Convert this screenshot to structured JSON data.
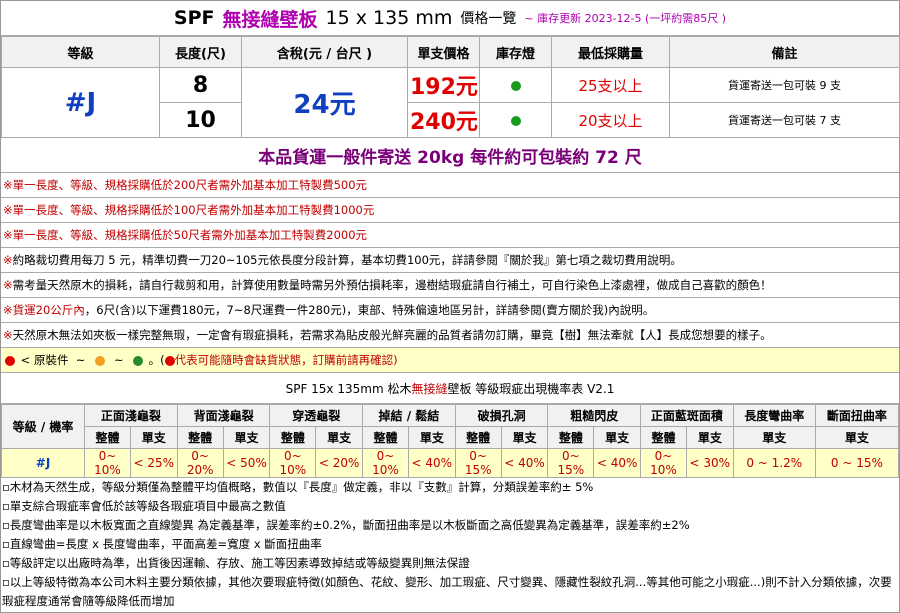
{
  "title": {
    "brand": "SPF",
    "product": "無接縫壁板",
    "spec": "15 x 135 mm",
    "suffix": "價格一覽",
    "update": "~ 庫存更新 2023-12-5 (一坪約需85尺 )"
  },
  "table": {
    "headers": [
      "等級",
      "長度(尺)",
      "含稅(元 / 台尺 )",
      "單支價格",
      "庫存燈",
      "最低採購量",
      "備註"
    ],
    "grade": "#J",
    "price_per_ft": "24元",
    "rows": [
      {
        "length": "8",
        "unit_price": "192元",
        "stock": "green",
        "min_buy": "25支以上",
        "note": "貨運寄送一包可裝 9 支"
      },
      {
        "length": "10",
        "unit_price": "240元",
        "stock": "green",
        "min_buy": "20支以上",
        "note": "貨運寄送一包可裝 7 支"
      }
    ]
  },
  "shipping": "本品貨運一般件寄送 20kg 每件約可包裝約 72 尺",
  "notes": [
    {
      "text": "※單一長度、等級、規格採購低於200尺者需外加基本加工特製費500元",
      "color": "red"
    },
    {
      "text": "※單一長度、等級、規格採購低於100尺者需外加基本加工特製費1000元",
      "color": "red"
    },
    {
      "text": "※單一長度、等級、規格採購低於50尺者需外加基本加工特製費2000元",
      "color": "red"
    },
    {
      "text": "約略裁切費用每刀 5 元，精準切費一刀20~105元依長度分段計算，基本切費100元，詳請參閱『關於我』第七項之裁切費用說明。",
      "color": "black",
      "mark": "※"
    },
    {
      "text": "需考量天然原木的損耗，請自行裁剪和用，計算使用數量時需另外預估損耗率，邊樹結瑕疵請自行補土，可自行染色上漆處裡，做成自己喜歡的顏色！",
      "color": "black",
      "mark": "※"
    },
    {
      "text": "貨運20公斤內，6尺(含)以下運費180元，7~8尺運費一件280元)，東部、特殊偏遠地區另計，詳請參閱(賣方關於我)內說明。",
      "color": "black",
      "mark": "※",
      "lead_red": "貨運20公斤內"
    },
    {
      "text": "天然原木無法如夾板一樣完整無瑕，一定會有瑕疵損耗，若需求為貼皮般光鮮亮麗的品質者請勿訂購，畢竟【樹】無法牽就【人】長成您想要的樣子。",
      "color": "black",
      "mark": "※"
    }
  ],
  "legend": {
    "label": "< 原裝件",
    "sep": "~",
    "tail": "。(",
    "warning": "代表可能隨時會缺貨狀態，訂購前請再確認)",
    "colors": {
      "red": "#e00000",
      "orange": "#f0a020",
      "green": "#2a8a2a",
      "dot_red": "#e00000"
    }
  },
  "defect": {
    "title_prefix": "SPF 15x 135mm 松木",
    "title_red": "無接縫",
    "title_suffix": "壁板 等級瑕疵出現機率表 V2.1",
    "corner": "等級 / 機率",
    "groups": [
      "正面淺龜裂",
      "背面淺龜裂",
      "穿透龜裂",
      "掉結 / 鬆結",
      "破損孔洞",
      "粗糙閃皮",
      "正面藍斑面積",
      "長度彎曲率",
      "斷面扭曲率"
    ],
    "sub_whole": "整體",
    "sub_single": "單支",
    "row_grade": "#J",
    "values": [
      "0~ 10%",
      "< 25%",
      "0~ 20%",
      "< 50%",
      "0~ 10%",
      "< 20%",
      "0~ 10%",
      "< 40%",
      "0~ 15%",
      "< 40%",
      "0~ 15%",
      "< 40%",
      "0~ 10%",
      "< 30%",
      "0 ~ 1.2%",
      "0 ~ 15%"
    ]
  },
  "footnotes": [
    "▫木材為天然生成，等級分類僅為整體平均值概略，數值以『長度』做定義，非以『支數』計算，分類誤差率約± 5%",
    "▫單支綜合瑕疵率會低於該等級各瑕疵項目中最高之數值",
    "▫長度彎曲率是以木板寬面之直線變異 為定義基準，誤差率約±0.2%，斷面扭曲率是以木板斷面之高低變異為定義基準，誤差率約±2%",
    "▫直線彎曲=長度 x 長度彎曲率，平面高差=寬度 x 斷面扭曲率",
    "▫等級評定以出廠時為準，出貨後因運輸、存放、施工等因素導致掉結或等級變異則無法保證",
    "▫以上等級特徵為本公司木料主要分類依據，其他次要瑕疵特徵(如顏色、花紋、變形、加工瑕疵、尺寸變異、隱藏性裂紋孔洞...等其他可能之小瑕疵...)則不計入分類依據，次要瑕疵程度通常會隨等級降低而增加"
  ]
}
